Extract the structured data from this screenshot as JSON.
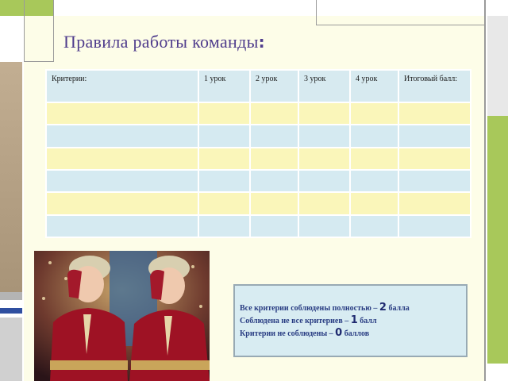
{
  "slide": {
    "title": "Правила работы команды",
    "title_colon": ":"
  },
  "table": {
    "headers": [
      "Критерии:",
      "1 урок",
      "2 урок",
      "3 урок",
      "4 урок",
      "Итоговый балл:"
    ],
    "rows": [
      [
        "",
        "",
        "",
        "",
        "",
        ""
      ],
      [
        "",
        "",
        "",
        "",
        "",
        ""
      ],
      [
        "",
        "",
        "",
        "",
        "",
        ""
      ],
      [
        "",
        "",
        "",
        "",
        "",
        ""
      ],
      [
        "",
        "",
        "",
        "",
        "",
        ""
      ],
      [
        "",
        "",
        "",
        "",
        "",
        ""
      ]
    ]
  },
  "scoring": {
    "lines": [
      {
        "text_before": "Все критерии соблюдены полностью –",
        "number": "2",
        "text_after": "балла"
      },
      {
        "text_before": "Соблюдена не все критериев –",
        "number": "1",
        "text_after": "балл"
      },
      {
        "text_before": "Критерии не соблюдены –",
        "number": "0",
        "text_after": "баллов"
      }
    ]
  },
  "colors": {
    "title": "#4f3c8c",
    "header_row": "#d7eaf0",
    "row_yellow": "#faf6ba",
    "row_blue": "#d5eaf1",
    "deco_green": "#a8c85a",
    "deco_gray": "#a6a6a6",
    "deco_tan": "#b8a488",
    "deco_blue": "#2f4fa0"
  }
}
